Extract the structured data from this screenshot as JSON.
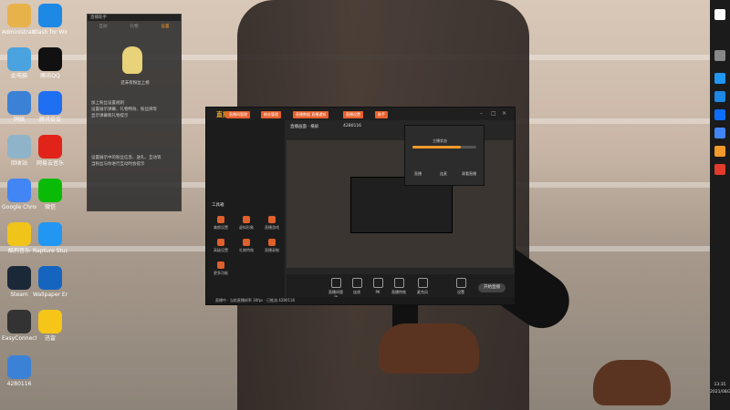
{
  "desktop": {
    "icons": [
      {
        "label": "Administrator",
        "color": "#e8b24a"
      },
      {
        "label": "Clash for Windows",
        "color": "#1e88e5"
      },
      {
        "label": "此电脑",
        "color": "#4aa3df"
      },
      {
        "label": "腾讯QQ",
        "color": "#111111"
      },
      {
        "label": "网络",
        "color": "#3b82d6"
      },
      {
        "label": "腾讯会议",
        "color": "#1e6ff1"
      },
      {
        "label": "回收站",
        "color": "#8fb3c9"
      },
      {
        "label": "网易云音乐",
        "color": "#e2231a"
      },
      {
        "label": "Google Chrome",
        "color": "#4285f4"
      },
      {
        "label": "微信",
        "color": "#09bb07"
      },
      {
        "label": "酷狗音乐",
        "color": "#f0c419"
      },
      {
        "label": "Rapture Studio",
        "color": "#2196f3"
      },
      {
        "label": "Steam",
        "color": "#1b2838"
      },
      {
        "label": "Wallpaper Engine",
        "color": "#1565c0"
      },
      {
        "label": "EasyConnect",
        "color": "#333333"
      },
      {
        "label": "迅雷",
        "color": "#f5c518"
      },
      {
        "label": "4280116",
        "color": "#3b82d6"
      }
    ]
  },
  "left_panel": {
    "title": "直播助手",
    "tabs": [
      "互动",
      "礼物",
      "设置"
    ],
    "tip": "还未有粉丝上榜",
    "lines": [
      "加上粉丝设置规则",
      "设置展示弹幕、礼物特效、粉丝牌等",
      "显示弹幕和礼物提示",
      "设置展示中的粉丝信息、送礼、互动等",
      "当粉丝与你进行互动时会提示"
    ]
  },
  "main_window": {
    "app_name": "直播伴侣",
    "tabs": [
      "直播间管理",
      "粉丝管理",
      "直播数据 直播通知",
      "直播设置",
      "助手"
    ],
    "room_label": "直播画面 · 横屏",
    "viewers": "4280116",
    "sidebar_title": "工具箱",
    "sidebar_items": [
      "美颜设置",
      "虚拟形象",
      "直播游戏",
      "高级设置",
      "礼物特效",
      "直播录制",
      "更多功能"
    ],
    "bottom_buttons": [
      "直播间管理",
      "连线",
      "PK",
      "直播特效",
      "麦克风",
      "设置",
      "开始直播"
    ],
    "popup": {
      "title": "主播状态",
      "label_a": "直播",
      "label_b": "连麦",
      "label_c": "观看直播"
    },
    "progress": 0.75,
    "status_text": "直播中 · 当前直播帧率 30fps · 已推流 4280116"
  },
  "taskbar": {
    "time": "13:35",
    "date": "2021/08/21"
  }
}
